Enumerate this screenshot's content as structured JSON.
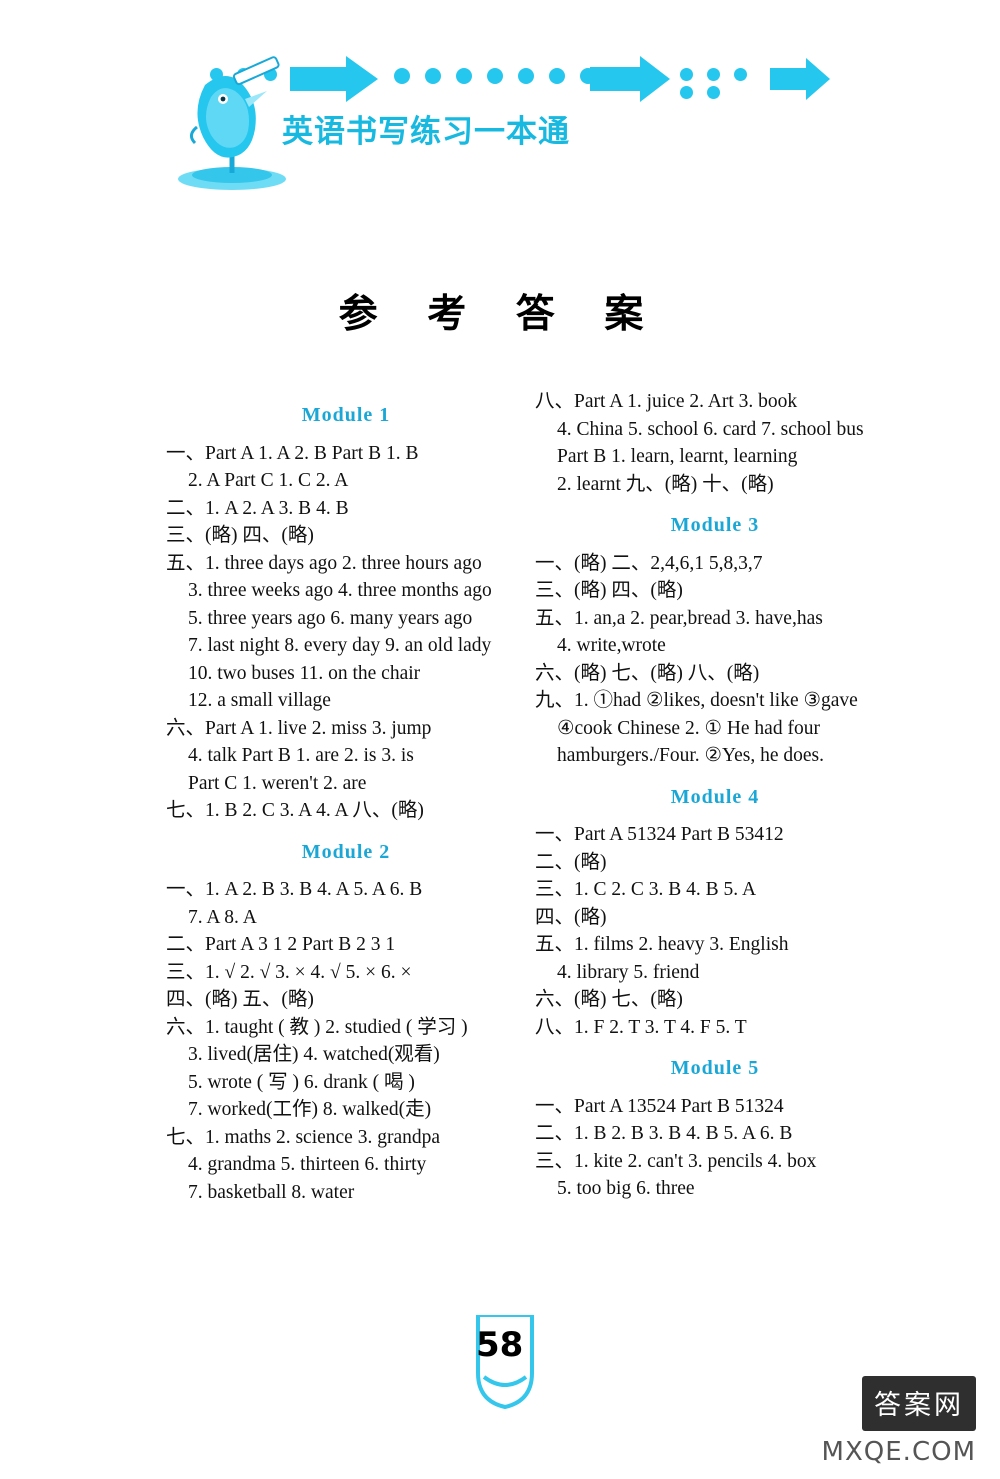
{
  "header": {
    "title_cn": "英语书写练习一本通",
    "logo_icon": "bird-pen-logo-icon",
    "arrow_icon": "right-arrow-icon"
  },
  "main_title": "参 考 答 案",
  "page_number": "58",
  "watermark": {
    "box_text": "答案网",
    "sub_text": "MXQE.COM"
  },
  "columns": {
    "left": [
      {
        "type": "module",
        "label": "Module  1"
      },
      {
        "type": "line",
        "text": "一、Part A  1. A  2. B  Part B  1. B"
      },
      {
        "type": "line",
        "indent": 1,
        "text": "2. A  Part C  1. C  2. A"
      },
      {
        "type": "line",
        "text": "二、1. A  2. A  3. B  4. B"
      },
      {
        "type": "line",
        "text": "三、(略)  四、(略)"
      },
      {
        "type": "line",
        "text": "五、1. three days ago  2. three hours ago"
      },
      {
        "type": "line",
        "indent": 1,
        "text": "3. three weeks ago  4. three months ago"
      },
      {
        "type": "line",
        "indent": 1,
        "text": "5. three years ago  6. many years ago"
      },
      {
        "type": "line",
        "indent": 1,
        "text": "7. last night  8. every day  9. an old lady"
      },
      {
        "type": "line",
        "indent": 1,
        "text": "10. two buses  11. on the chair"
      },
      {
        "type": "line",
        "indent": 1,
        "text": "12. a small village"
      },
      {
        "type": "line",
        "text": "六、Part A  1. live  2. miss  3. jump"
      },
      {
        "type": "line",
        "indent": 1,
        "text": "4. talk  Part B  1. are  2. is  3. is"
      },
      {
        "type": "line",
        "indent": 1,
        "text": "Part C  1. weren't  2. are"
      },
      {
        "type": "line",
        "text": "七、1. B  2. C  3. A  4. A  八、(略)"
      },
      {
        "type": "module",
        "label": "Module  2"
      },
      {
        "type": "line",
        "text": "一、1. A  2. B  3. B  4. A  5. A  6. B"
      },
      {
        "type": "line",
        "indent": 1,
        "text": "7. A  8. A"
      },
      {
        "type": "line",
        "text": "二、Part A  3 1 2  Part B  2 3 1"
      },
      {
        "type": "line",
        "text": "三、1. √  2. √  3. ×  4. √  5. ×  6. ×"
      },
      {
        "type": "line",
        "text": "四、(略)  五、(略)"
      },
      {
        "type": "line",
        "text": "六、1. taught ( 教 )   2. studied ( 学习 )"
      },
      {
        "type": "line",
        "indent": 1,
        "text": "3. lived(居住)  4. watched(观看)"
      },
      {
        "type": "line",
        "indent": 1,
        "text": "5. wrote ( 写 )      6. drank ( 喝 )"
      },
      {
        "type": "line",
        "indent": 1,
        "text": "7. worked(工作)  8. walked(走)"
      },
      {
        "type": "line",
        "text": "七、1. maths  2. science  3. grandpa"
      },
      {
        "type": "line",
        "indent": 1,
        "text": "4. grandma  5. thirteen  6. thirty"
      },
      {
        "type": "line",
        "indent": 1,
        "text": "7. basketball  8. water"
      }
    ],
    "right": [
      {
        "type": "line",
        "text": "八、Part A  1. juice  2. Art  3. book"
      },
      {
        "type": "line",
        "indent": 1,
        "text": "4. China  5. school  6. card  7. school bus"
      },
      {
        "type": "line",
        "indent": 1,
        "text": "Part B  1. learn, learnt, learning"
      },
      {
        "type": "line",
        "indent": 1,
        "text": "2. learnt  九、(略)  十、(略)"
      },
      {
        "type": "module",
        "label": "Module  3"
      },
      {
        "type": "line",
        "text": "一、(略)  二、2,4,6,1  5,8,3,7"
      },
      {
        "type": "line",
        "text": "三、(略)  四、(略)"
      },
      {
        "type": "line",
        "text": "五、1. an,a  2. pear,bread  3. have,has"
      },
      {
        "type": "line",
        "indent": 1,
        "text": "4. write,wrote"
      },
      {
        "type": "line",
        "text": "六、(略)  七、(略)  八、(略)"
      },
      {
        "type": "line",
        "text": "九、1. ①had  ②likes, doesn't like  ③gave"
      },
      {
        "type": "line",
        "indent": 1,
        "text": "④cook Chinese   2. ① He had four"
      },
      {
        "type": "line",
        "indent": 1,
        "text": "hamburgers./Four.  ②Yes, he does."
      },
      {
        "type": "module",
        "label": "Module  4"
      },
      {
        "type": "line",
        "text": "一、Part A  51324  Part B  53412"
      },
      {
        "type": "line",
        "text": "二、(略)"
      },
      {
        "type": "line",
        "text": "三、1. C  2. C  3. B  4. B  5. A"
      },
      {
        "type": "line",
        "text": "四、(略)"
      },
      {
        "type": "line",
        "text": "五、1. films    2. heavy    3. English"
      },
      {
        "type": "line",
        "indent": 1,
        "text": "4. library  5. friend"
      },
      {
        "type": "line",
        "text": "六、(略)  七、(略)"
      },
      {
        "type": "line",
        "text": "八、1. F  2. T  3. T  4. F  5. T"
      },
      {
        "type": "module",
        "label": "Module  5"
      },
      {
        "type": "line",
        "text": "一、Part A  13524  Part B  51324"
      },
      {
        "type": "line",
        "text": "二、1. B  2. B  3. B  4. B  5. A  6. B"
      },
      {
        "type": "line",
        "text": "三、1. kite  2. can't  3. pencils  4. box"
      },
      {
        "type": "line",
        "indent": 1,
        "text": "5. too big  6. three"
      }
    ]
  }
}
